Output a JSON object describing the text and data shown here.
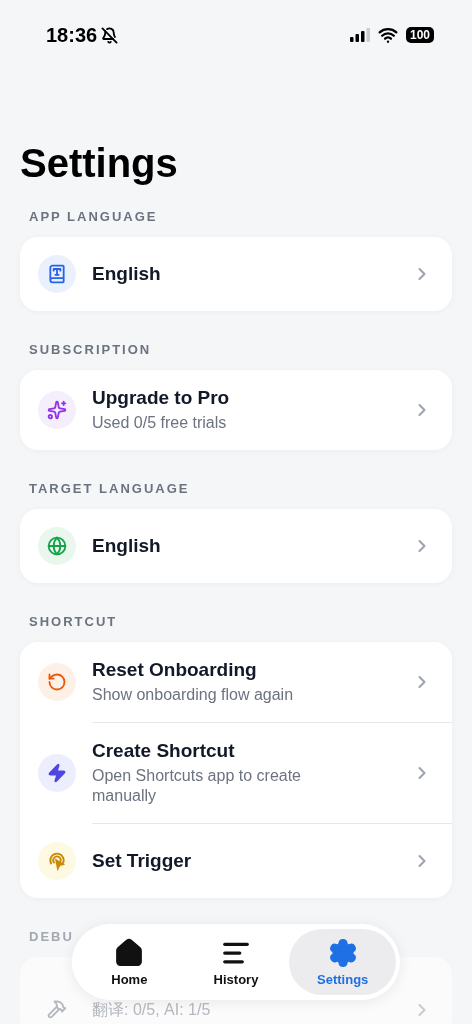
{
  "status_bar": {
    "time": "18:36",
    "battery": "100"
  },
  "title": "Settings",
  "sections": [
    {
      "header": "APP LANGUAGE",
      "dimmed": false,
      "items": [
        {
          "kind": "language",
          "title": "English"
        }
      ]
    },
    {
      "header": "SUBSCRIPTION",
      "dimmed": false,
      "items": [
        {
          "kind": "upgrade",
          "title": "Upgrade to Pro",
          "subtitle": "Used 0/5 free trials"
        }
      ]
    },
    {
      "header": "TARGET LANGUAGE",
      "dimmed": false,
      "items": [
        {
          "kind": "target",
          "title": "English"
        }
      ]
    },
    {
      "header": "SHORTCUT",
      "dimmed": false,
      "items": [
        {
          "kind": "reset",
          "title": "Reset Onboarding",
          "subtitle": "Show onboarding flow again"
        },
        {
          "kind": "shortcut",
          "title": "Create Shortcut",
          "subtitle": "Open Shortcuts app to create manually"
        },
        {
          "kind": "trigger",
          "title": "Set Trigger"
        }
      ]
    },
    {
      "header": "DEBU",
      "dimmed": true,
      "items": [
        {
          "kind": "debug",
          "subtitle": "翻译: 0/5, AI: 1/5"
        }
      ]
    }
  ],
  "tabs": [
    {
      "kind": "home",
      "label": "Home",
      "selected": false
    },
    {
      "kind": "history",
      "label": "History",
      "selected": false
    },
    {
      "kind": "settings",
      "label": "Settings",
      "selected": true
    }
  ]
}
